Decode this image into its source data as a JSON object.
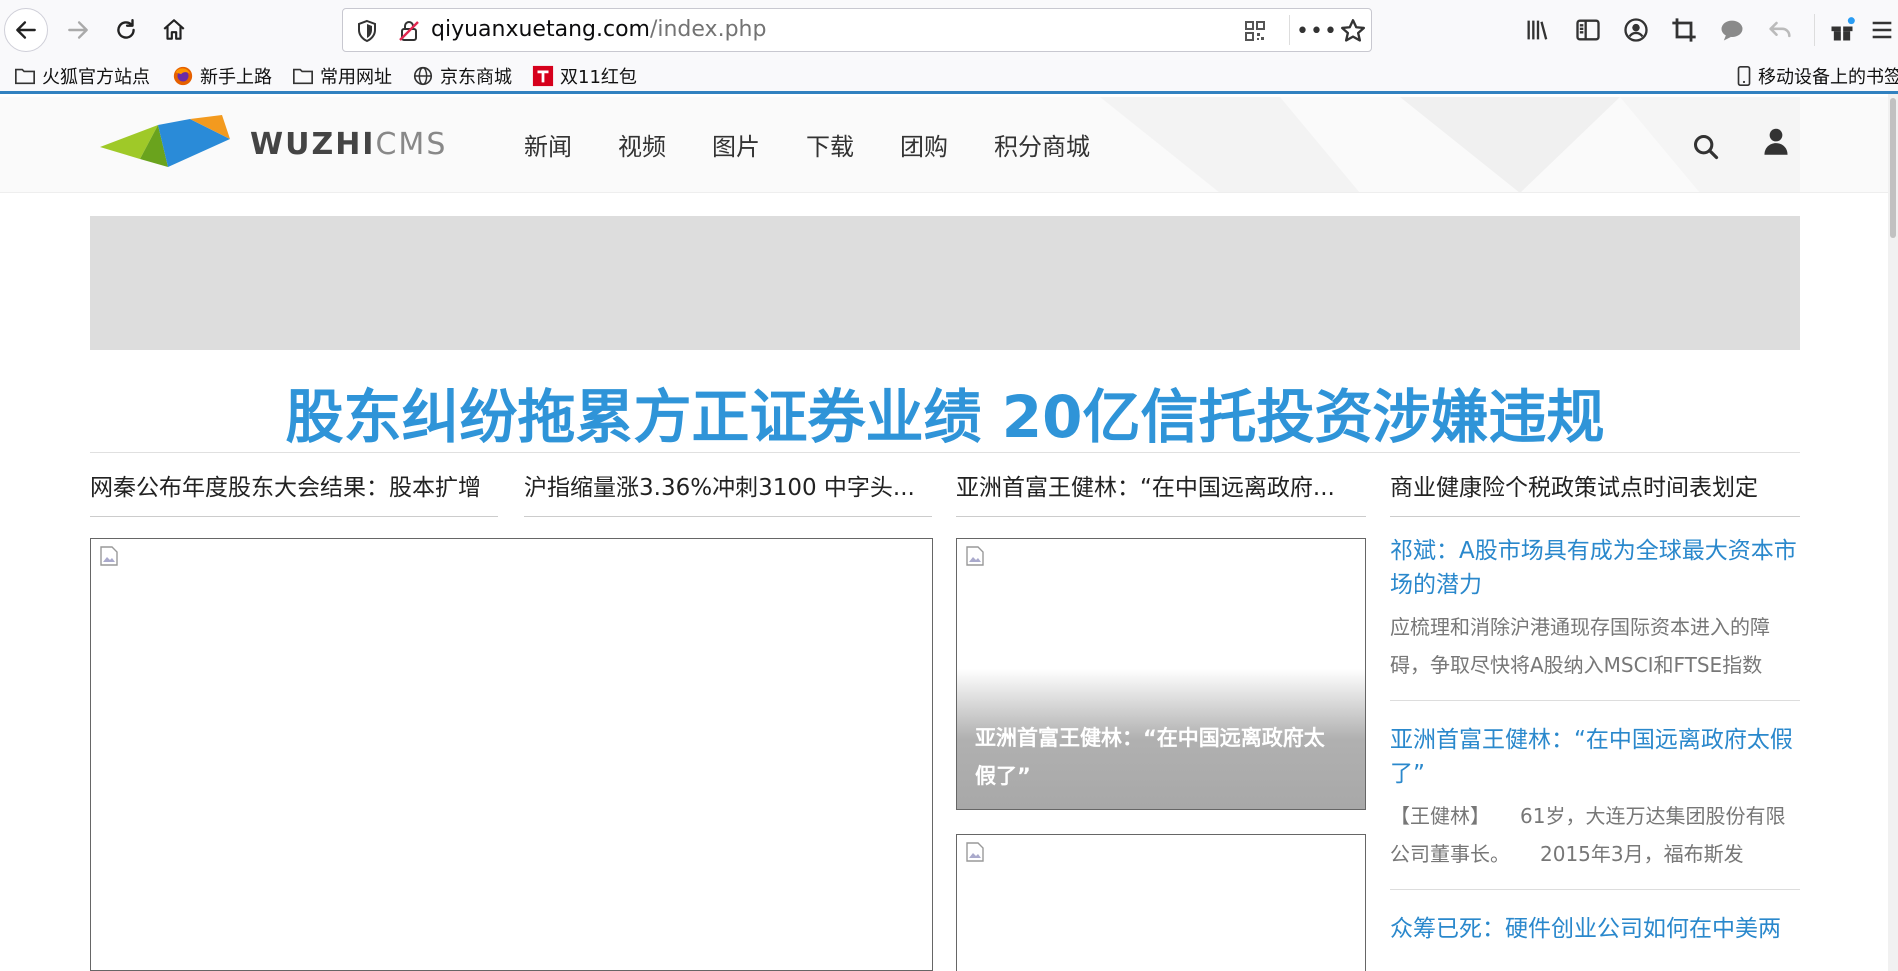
{
  "browser": {
    "url_domain": "qiyuanxuetang.com",
    "url_path": "/index.php",
    "more_label": "•••",
    "bookmarks": [
      {
        "label": "火狐官方站点"
      },
      {
        "label": "新手上路"
      },
      {
        "label": "常用网址"
      },
      {
        "label": "京东商城"
      },
      {
        "label": "双11红包"
      }
    ],
    "mobile_bookmarks": "移动设备上的书签"
  },
  "site": {
    "logo_main": "WUZHI",
    "logo_accent": "CMS",
    "nav": [
      "新闻",
      "视频",
      "图片",
      "下载",
      "团购",
      "积分商城"
    ]
  },
  "main": {
    "headline": "股东纠纷拖累方正证券业绩 20亿信托投资涉嫌违规",
    "sub_links": [
      "网秦公布年度股东大会结果：股本扩增",
      "沪指缩量涨3.36%冲刺3100 中字头...",
      "亚洲首富王健林：“在中国远离政府...",
      "商业健康险个税政策试点时间表划定"
    ],
    "feature_caption": "亚洲首富王健林：“在中国远离政府太假了”"
  },
  "sidebar": [
    {
      "title": "祁斌：A股市场具有成为全球最大资本市场的潜力",
      "desc": "应梳理和消除沪港通现存国际资本进入的障碍，争取尽快将A股纳入MSCI和FTSE指数"
    },
    {
      "title": "亚洲首富王健林：“在中国远离政府太假了”",
      "desc": "【王健林】　　61岁，大连万达集团股份有限公司董事长。　　2015年3月，福布斯发"
    },
    {
      "title": "众筹已死：硬件创业公司如何在中美两",
      "desc": ""
    }
  ]
}
